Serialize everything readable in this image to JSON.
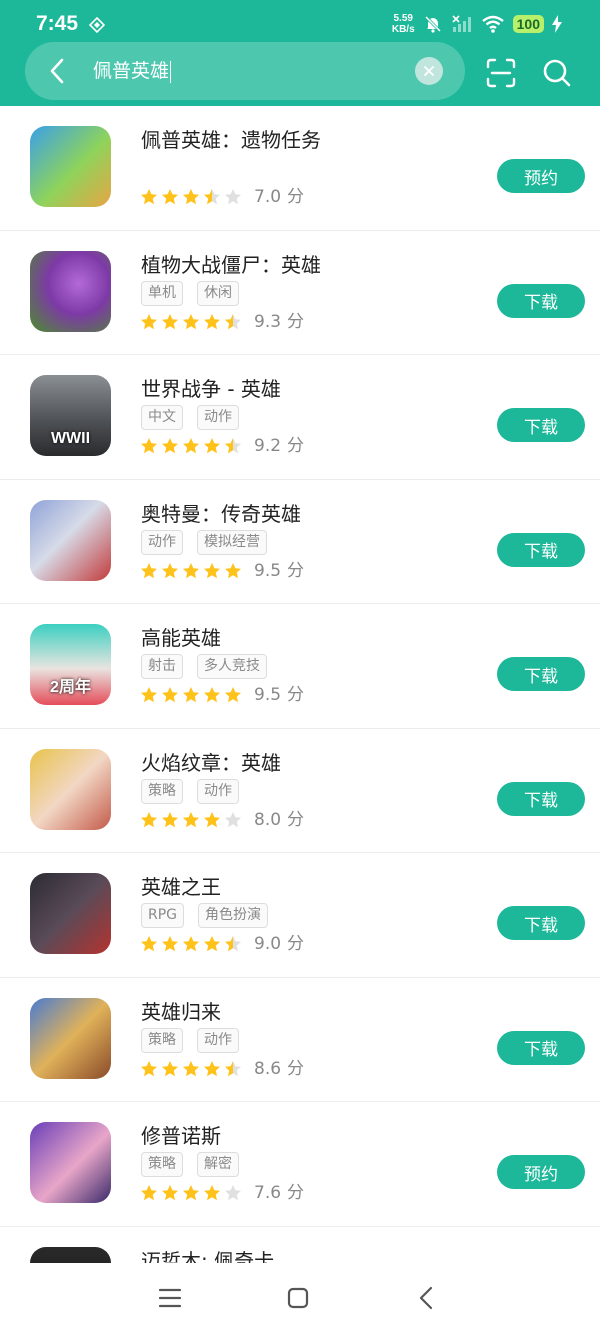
{
  "status": {
    "time": "7:45",
    "net_speed_value": "5.59",
    "net_speed_unit": "KB/s",
    "battery": "100"
  },
  "search": {
    "query": "佩普英雄"
  },
  "icons": [
    "back-icon",
    "clear-icon",
    "scan-icon",
    "search-icon",
    "star-icon",
    "menu-icon",
    "home-icon",
    "nav-back-icon"
  ],
  "colors": {
    "accent": "#1db899",
    "star": "#ffc21a",
    "star_empty": "#e0e0e0"
  },
  "score_unit": "分",
  "apps": [
    {
      "name": "佩普英雄：遗物任务",
      "tags": [],
      "rating": 3.5,
      "score": "7.0",
      "action": "预约",
      "icon_caption": "",
      "icon_bg": "linear-gradient(135deg,#3aa0e8 0%,#8fd35b 55%,#e7a544 100%)"
    },
    {
      "name": "植物大战僵尸：英雄",
      "tags": [
        "单机",
        "休闲"
      ],
      "rating": 4.5,
      "score": "9.3",
      "action": "下载",
      "icon_caption": "",
      "icon_bg": "radial-gradient(circle at 60% 40%,#b36ad8 0%,#7d3aa6 45%,#4a8f2a 100%)"
    },
    {
      "name": "世界战争 - 英雄",
      "tags": [
        "中文",
        "动作"
      ],
      "rating": 4.5,
      "score": "9.2",
      "action": "下载",
      "icon_caption": "WWII",
      "icon_bg": "linear-gradient(180deg,#8a8f94 0%,#4b4e52 60%,#2a2b2d 100%)"
    },
    {
      "name": "奥特曼：传奇英雄",
      "tags": [
        "动作",
        "模拟经营"
      ],
      "rating": 5,
      "score": "9.5",
      "action": "下载",
      "icon_caption": "",
      "icon_bg": "linear-gradient(135deg,#8fa3d8 0%,#d7dbe8 45%,#c23b3b 100%)"
    },
    {
      "name": "高能英雄",
      "tags": [
        "射击",
        "多人竞技"
      ],
      "rating": 5,
      "score": "9.5",
      "action": "下载",
      "icon_caption": "2周年",
      "icon_bg": "linear-gradient(180deg,#3bcfc0 0%,#e9e4e0 55%,#e44d5a 100%)"
    },
    {
      "name": "火焰纹章：英雄",
      "tags": [
        "策略",
        "动作"
      ],
      "rating": 4,
      "score": "8.0",
      "action": "下载",
      "icon_caption": "",
      "icon_bg": "linear-gradient(135deg,#e8c34a 0%,#f2d7c4 50%,#c45a4a 100%)"
    },
    {
      "name": "英雄之王",
      "tags": [
        "RPG",
        "角色扮演"
      ],
      "rating": 4.5,
      "score": "9.0",
      "action": "下载",
      "icon_caption": "",
      "icon_bg": "linear-gradient(135deg,#2b2b33 0%,#5a4b58 50%,#b5322e 100%)"
    },
    {
      "name": "英雄归来",
      "tags": [
        "策略",
        "动作"
      ],
      "rating": 4.5,
      "score": "8.6",
      "action": "下载",
      "icon_caption": "",
      "icon_bg": "linear-gradient(135deg,#4a7bd0 0%,#e0b25a 50%,#8a4a2a 100%)"
    },
    {
      "name": "修普诺斯",
      "tags": [
        "策略",
        "解密"
      ],
      "rating": 4,
      "score": "7.6",
      "action": "预约",
      "icon_caption": "",
      "icon_bg": "linear-gradient(135deg,#6a3fb8 0%,#e8a6c8 55%,#3a2a6a 100%)"
    },
    {
      "name": "迈哲木: 佩奇卡",
      "tags": [],
      "rating": 0,
      "score": "",
      "action": "",
      "icon_caption": "",
      "icon_bg": "linear-gradient(180deg,#2a2a2a 0%,#111 100%)"
    }
  ]
}
